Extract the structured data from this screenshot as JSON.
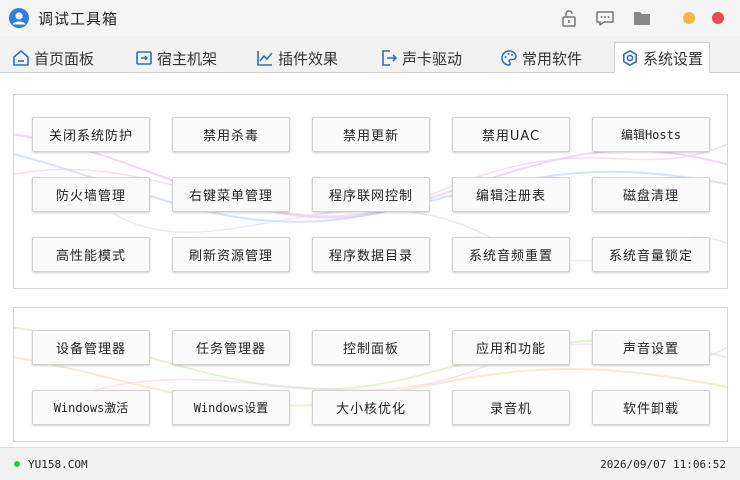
{
  "window": {
    "title": "调试工具箱",
    "controls": {
      "minimize_color": "#f5b840",
      "close_color": "#ee4c4c"
    }
  },
  "tabs": [
    {
      "label": "首页面板",
      "icon": "home-icon"
    },
    {
      "label": "宿主机架",
      "icon": "host-icon"
    },
    {
      "label": "插件效果",
      "icon": "chart-line-icon"
    },
    {
      "label": "声卡驱动",
      "icon": "export-icon"
    },
    {
      "label": "常用软件",
      "icon": "palette-icon"
    },
    {
      "label": "系统设置",
      "icon": "gear-icon",
      "active": true
    }
  ],
  "system_group": {
    "buttons": [
      "关闭系统防护",
      "禁用杀毒",
      "禁用更新",
      "禁用UAC",
      "编辑Hosts",
      "防火墙管理",
      "右键菜单管理",
      "程序联网控制",
      "编辑注册表",
      "磁盘清理",
      "高性能模式",
      "刷新资源管理",
      "程序数据目录",
      "系统音频重置",
      "系统音量锁定"
    ]
  },
  "tools_group": {
    "buttons": [
      "设备管理器",
      "任务管理器",
      "控制面板",
      "应用和功能",
      "声音设置",
      "Windows激活",
      "Windows设置",
      "大小核优化",
      "录音机",
      "软件卸载"
    ]
  },
  "status": {
    "site": "YU158.COM",
    "datetime": "2026/09/07 11:06:52",
    "indicator_color": "#2ecc40"
  }
}
